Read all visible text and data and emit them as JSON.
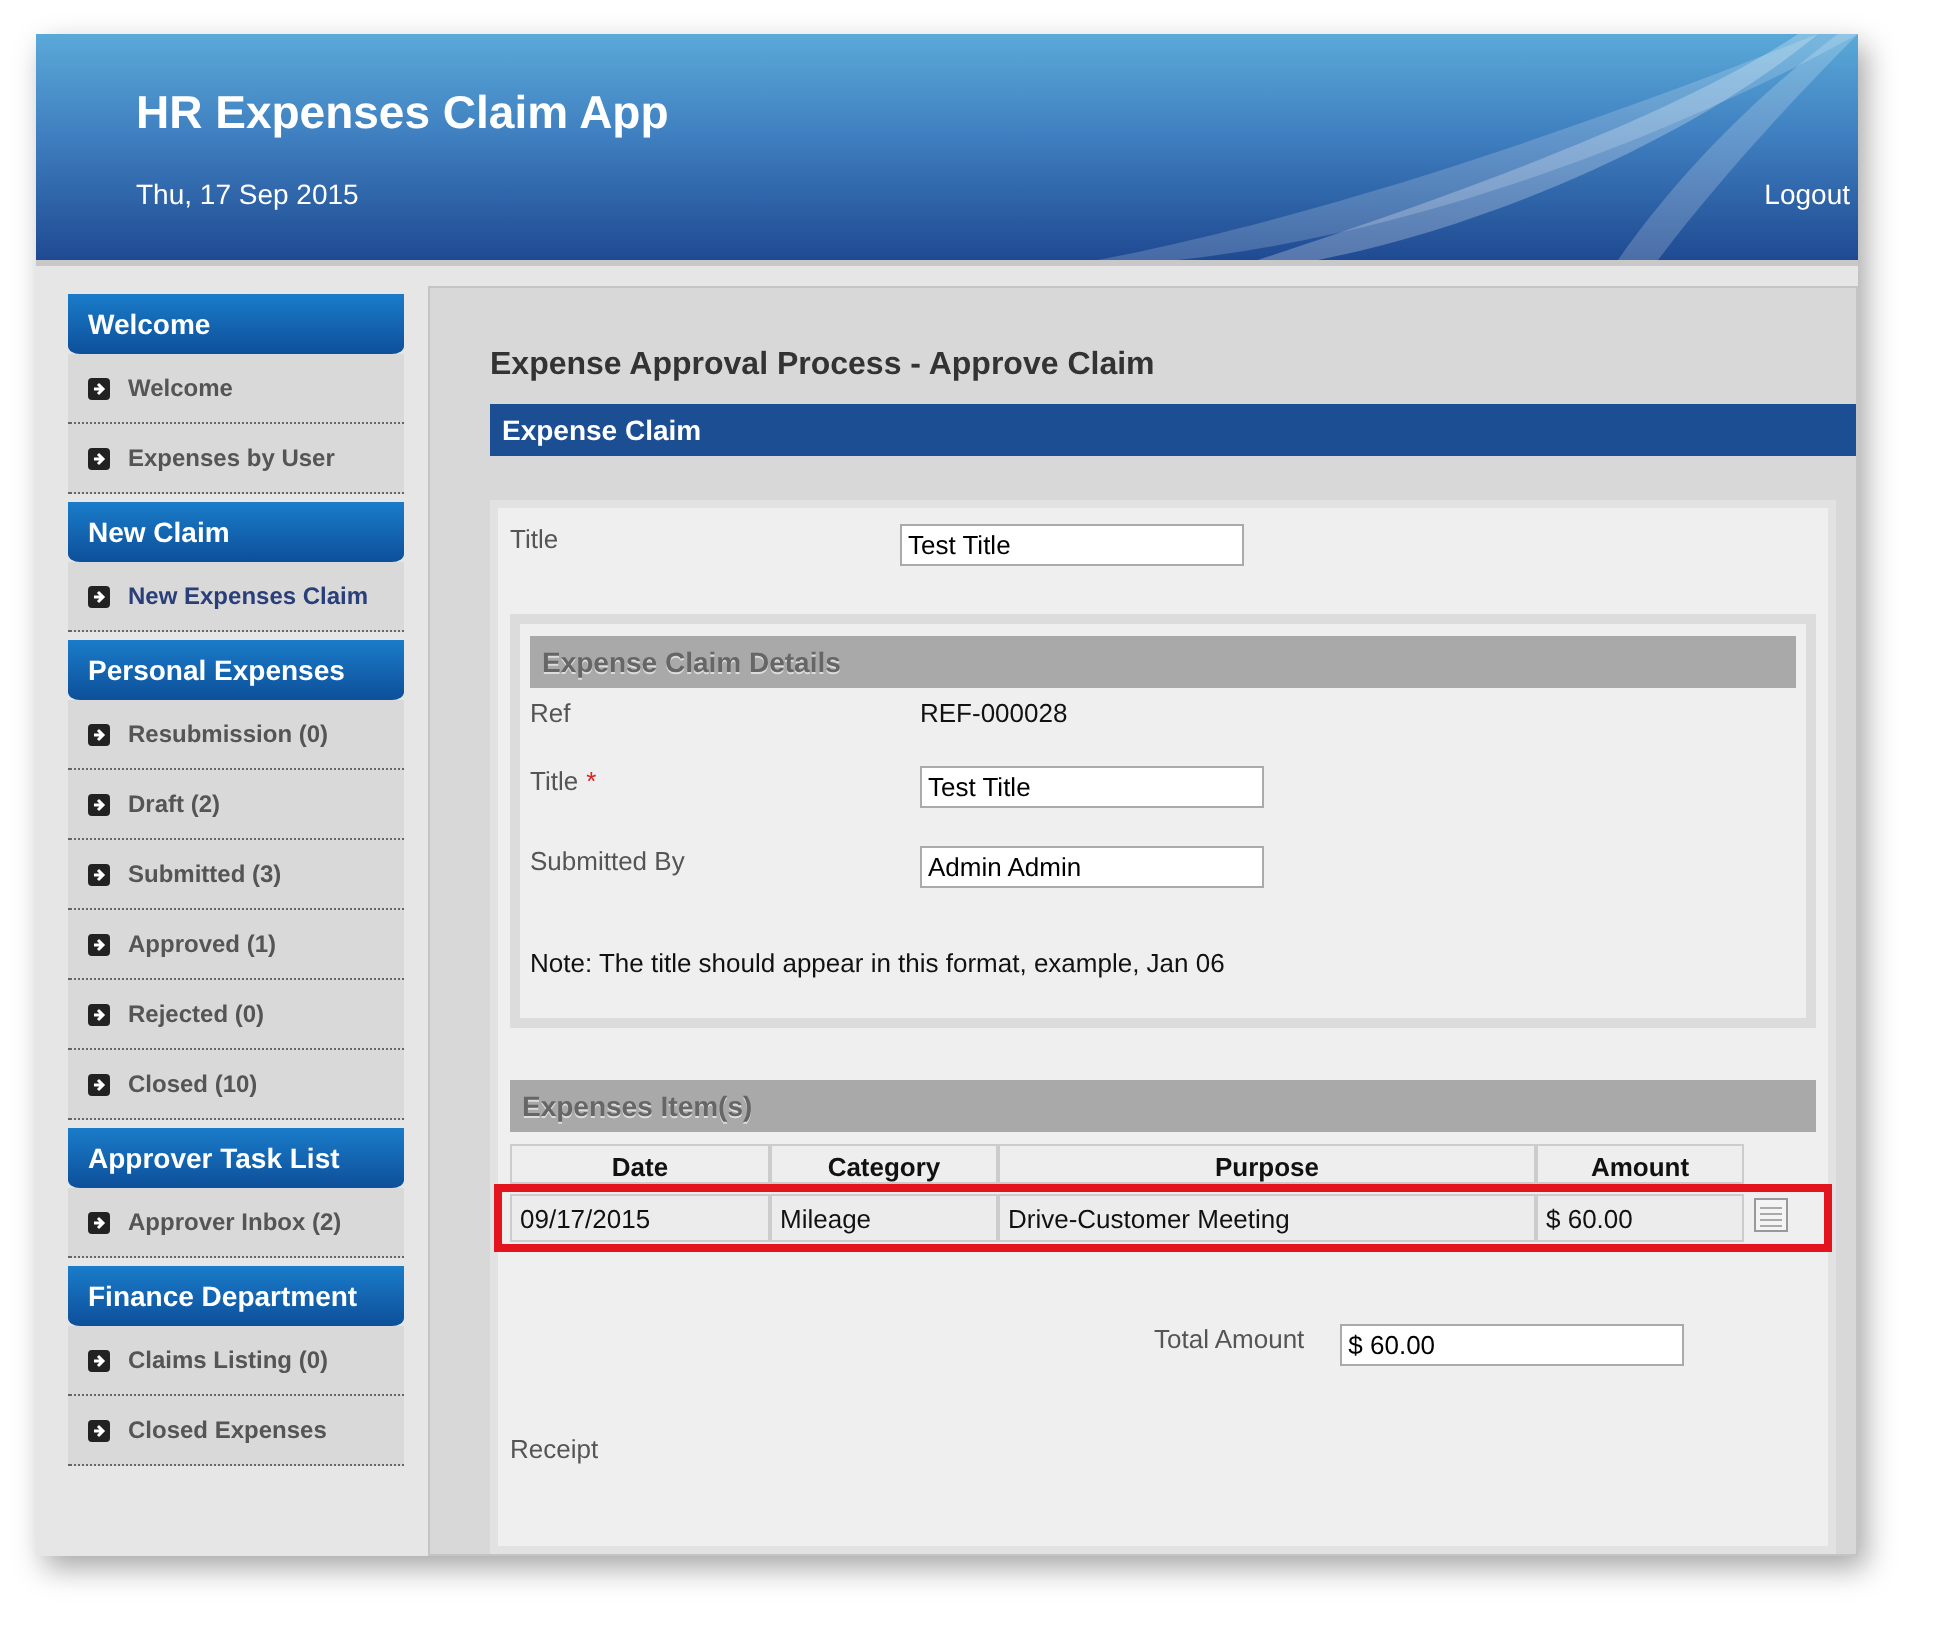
{
  "header": {
    "title": "HR Expenses Claim App",
    "date": "Thu, 17 Sep 2015",
    "logout": "Logout"
  },
  "sidebar": [
    {
      "heading": "Welcome",
      "items": [
        {
          "label": "Welcome",
          "selected": false
        },
        {
          "label": "Expenses by User",
          "selected": false
        }
      ]
    },
    {
      "heading": "New Claim",
      "items": [
        {
          "label": "New Expenses Claim",
          "selected": true
        }
      ]
    },
    {
      "heading": "Personal Expenses",
      "items": [
        {
          "label": "Resubmission (0)",
          "selected": false
        },
        {
          "label": "Draft (2)",
          "selected": false
        },
        {
          "label": "Submitted (3)",
          "selected": false
        },
        {
          "label": "Approved (1)",
          "selected": false
        },
        {
          "label": "Rejected (0)",
          "selected": false
        },
        {
          "label": "Closed (10)",
          "selected": false
        }
      ]
    },
    {
      "heading": "Approver Task List",
      "items": [
        {
          "label": "Approver Inbox (2)",
          "selected": false
        }
      ]
    },
    {
      "heading": "Finance Department",
      "items": [
        {
          "label": "Claims Listing (0)",
          "selected": false
        },
        {
          "label": "Closed Expenses",
          "selected": false
        }
      ]
    }
  ],
  "page_title": "Expense Approval Process - Approve Claim",
  "section_bar": "Expense Claim",
  "title_field": {
    "label": "Title",
    "value": "Test Title"
  },
  "details": {
    "heading": "Expense Claim Details",
    "ref_label": "Ref",
    "ref_value": "REF-000028",
    "fields": [
      {
        "label": "Title",
        "required_mark": "*",
        "value": "Test Title"
      },
      {
        "label": "Submitted By",
        "value": "Admin Admin"
      }
    ],
    "note": "Note: The title should appear in this format, example, Jan 06"
  },
  "items": {
    "heading": "Expenses Item(s)",
    "columns": [
      "Date",
      "Category",
      "Purpose",
      "Amount"
    ],
    "rows": [
      {
        "cells": [
          "09/17/2015",
          "Mileage",
          "Drive-Customer Meeting",
          "$ 60.00"
        ],
        "highlighted": true
      }
    ]
  },
  "total": {
    "label": "Total Amount",
    "value": "$ 60.00"
  },
  "receipt_label": "Receipt"
}
